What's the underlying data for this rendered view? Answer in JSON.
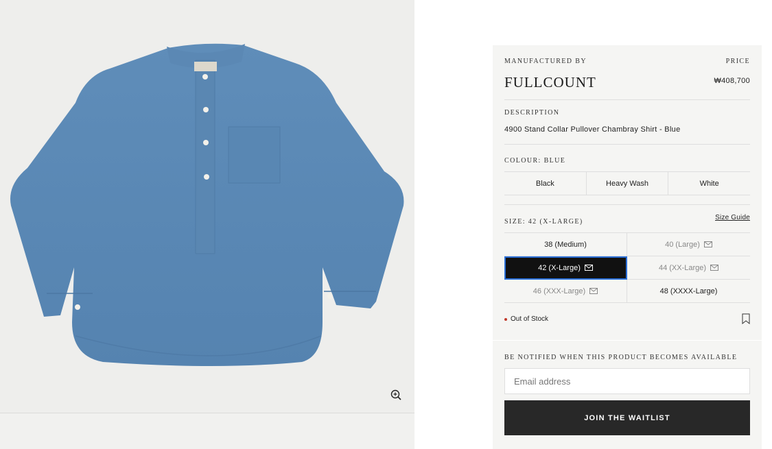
{
  "product": {
    "manufactured_by_label": "MANUFACTURED BY",
    "price_label": "PRICE",
    "brand": "FULLCOUNT",
    "price": "₩408,700",
    "description_label": "DESCRIPTION",
    "description": "4900 Stand Collar Pullover Chambray Shirt - Blue"
  },
  "colour": {
    "label": "COLOUR: BLUE",
    "options": [
      "Black",
      "Heavy Wash",
      "White"
    ]
  },
  "size": {
    "label": "SIZE: 42 (X-LARGE)",
    "guide_link": "Size Guide",
    "options": [
      {
        "label": "38 (Medium)",
        "status": "in-stock"
      },
      {
        "label": "40 (Large)",
        "status": "out-of-stock"
      },
      {
        "label": "42 (X-Large)",
        "status": "selected-out-of-stock"
      },
      {
        "label": "44 (XX-Large)",
        "status": "out-of-stock"
      },
      {
        "label": "46 (XXX-Large)",
        "status": "out-of-stock"
      },
      {
        "label": "48 (XXXX-Large)",
        "status": "in-stock"
      }
    ]
  },
  "stock": {
    "status_text": "Out of Stock",
    "status_color": "#c0392b"
  },
  "notify": {
    "label": "BE NOTIFIED WHEN THIS PRODUCT BECOMES AVAILABLE",
    "email_placeholder": "Email address",
    "button_label": "JOIN THE WAITLIST"
  },
  "icons": {
    "zoom": "zoom-in-icon",
    "mail": "mail-icon",
    "bookmark": "bookmark-icon"
  },
  "colors": {
    "panel_bg": "#f5f5f3",
    "button_bg": "#282828",
    "selected_bg": "#111111"
  }
}
